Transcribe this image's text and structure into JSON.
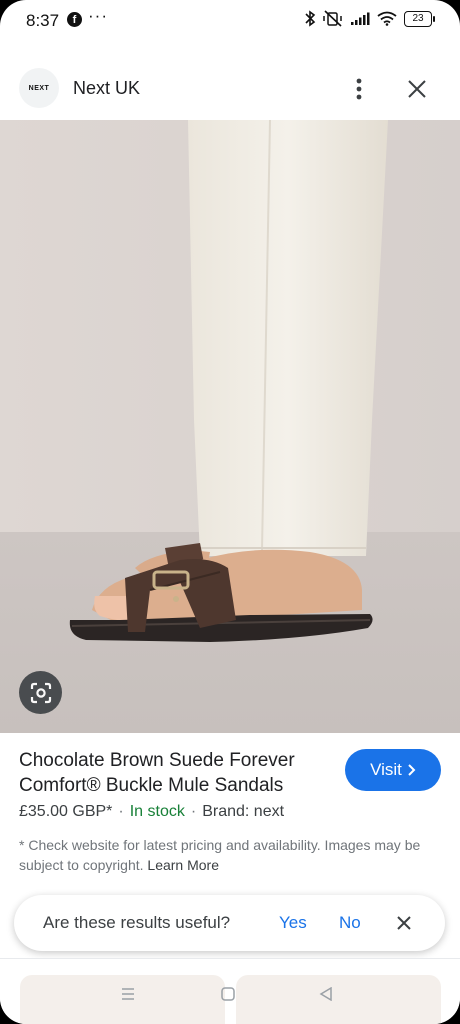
{
  "status_bar": {
    "time": "8:37",
    "notification_icons": [
      "facebook-icon",
      "more-notifications-icon"
    ],
    "system_icons": [
      "bluetooth-icon",
      "muted-vibrate-icon",
      "signal-icon",
      "wifi-icon",
      "battery-icon"
    ],
    "battery_level": "23"
  },
  "header": {
    "logo_text": "NEXT",
    "site_name": "Next UK",
    "icons": [
      "more-vert-icon",
      "close-icon"
    ]
  },
  "product": {
    "title": "Chocolate Brown Suede Forever Comfort® Buckle Mule Sandals",
    "visit_label": "Visit",
    "price": "£35.00 GBP*",
    "stock": "In stock",
    "brand": "Brand: next",
    "separator": "·",
    "disclaimer": "* Check website for latest pricing and availability. Images may be subject to copyright.",
    "learn_more": "Learn More"
  },
  "feedback": {
    "question": "Are these results useful?",
    "yes": "Yes",
    "no": "No"
  },
  "colors": {
    "accent": "#1a73e8",
    "in_stock": "#188038",
    "text_primary": "#202124",
    "text_secondary": "#70757a"
  },
  "nav_bar": {
    "icons": [
      "recents-icon",
      "home-icon",
      "back-icon"
    ]
  }
}
